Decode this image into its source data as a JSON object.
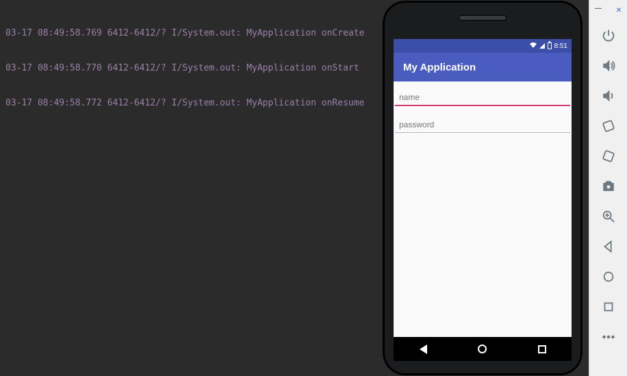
{
  "log": {
    "lines": [
      "03-17 08:49:58.769 6412-6412/? I/System.out: MyApplication onCreate",
      "03-17 08:49:58.770 6412-6412/? I/System.out: MyApplication onStart",
      "03-17 08:49:58.772 6412-6412/? I/System.out: MyApplication onResume"
    ]
  },
  "statusbar": {
    "time": "8:51"
  },
  "appbar": {
    "title": "My Application"
  },
  "form": {
    "name_placeholder": "name",
    "password_placeholder": "password"
  },
  "window": {
    "minimize": "–",
    "close": "×"
  },
  "toolbar_icons": {
    "power": "power-icon",
    "vol_up": "volume-up-icon",
    "vol_down": "volume-down-icon",
    "rotate_left": "rotate-left-icon",
    "rotate_right": "rotate-right-icon",
    "screenshot": "camera-icon",
    "zoom": "zoom-in-icon",
    "back": "back-icon",
    "home": "home-icon",
    "overview": "overview-icon",
    "more": "more-icon"
  }
}
